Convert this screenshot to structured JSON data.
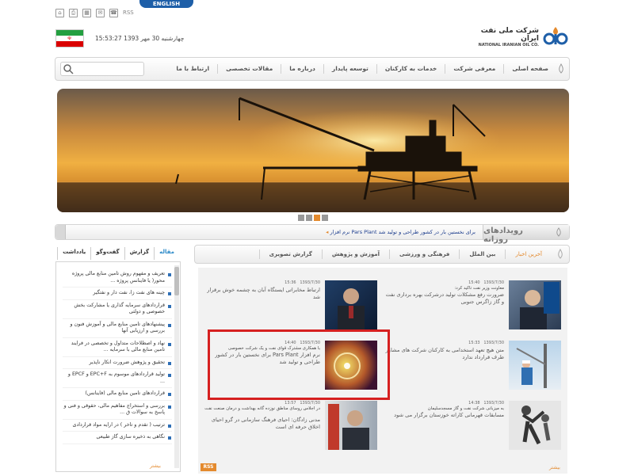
{
  "topbar": {
    "rss_label": "RSS",
    "language_tab": "ENGLISH",
    "icons": [
      "home-icon",
      "print-icon",
      "sitemap-icon",
      "mail-icon",
      "contact-icon"
    ]
  },
  "header": {
    "datetime": "چهارشنبه 30 مهر 1393    15:53:27",
    "logo_fa": "شرکت ملی نفت ایران",
    "logo_en": "NATIONAL IRANIAN OIL CO."
  },
  "nav": {
    "items": [
      "صفحه اصلی",
      "معرفی شرکت",
      "خدمات به کارکنان",
      "توسعه پایدار",
      "درباره ما",
      "مقالات تخصصی",
      "ارتباط با ما"
    ],
    "search_placeholder": ""
  },
  "ticker": {
    "title": "رویدادهای روزانه",
    "text": "نرم افزار Pars Plant برای نخستین بار در کشور طراحی و تولید شد"
  },
  "sidebar": {
    "tabs": [
      "مقاله",
      "گزارش",
      "گفت‌وگو",
      "یادداشت"
    ],
    "items": [
      "تعریف و مفهوم روش تامین منابع مالی پروژه محور( یا فاینانس پروژه ...",
      "چینه های نفت زا، نفت دار و نفتگیر",
      "قراردادهای سرمایه گذاری یا مشارکت بخش خصوصی و دولتی",
      "پیشنهادهای تامین منابع مالی و آموزش فنون و بررسی و ارزیابی آنها",
      "نهاد و اصطلاحات متداول و تخصصی در فرایند تامین منابع مالی با سرمایه ...",
      "تحقیق و پژوهش ضرورت انکار ناپذیر",
      "تولید قراردادهای موسوم به EPC+F و EPCF و ...",
      "قراردادهای تامین منابع مالی (فاینانس)",
      "بررسی و استخراج مفاهیم مالی، حقوقی و فنی و پاسخ به سوالات ق ...",
      "ترتیب ( تقدم و تاخر ) در ارایه مواد قراردادی",
      "نگاهی به ذخیره سازی گاز طبیعی"
    ],
    "more": "بیشتر"
  },
  "news": {
    "tabs": [
      "آخرین اخبار",
      "بین الملل",
      "فرهنگی و ورزشی",
      "آموزش و پژوهش",
      "گزارش تصویری"
    ],
    "items": [
      {
        "date": "1393/7/30",
        "time": "15:40",
        "subtitle": "معاونت وزیر نفت تاکید کرد:",
        "title": "ضرورت رفع مشکلات تولید درشرکت بهره برداری نفت و گاز زاگرس جنوبی"
      },
      {
        "date": "1393/7/30",
        "time": "15:36",
        "subtitle": "",
        "title": "ارتباط مخابراتی ایستگاه آبان به چشمه خوش برقرار شد"
      },
      {
        "date": "1393/7/30",
        "time": "15:33",
        "subtitle": "",
        "title": "متن هیچ تعهد استخدامی به کارکنان شرکت های مشاور طرف قرارداد ندارد"
      },
      {
        "date": "1393/7/30",
        "time": "14:40",
        "subtitle": "با همکاری مشترک قوای نفت و یک شرکت خصوصی",
        "title": "نرم افزار Pars Plant برای نخستین بار در کشور طراحی و تولید شد"
      },
      {
        "date": "1393/7/30",
        "time": "14:38",
        "subtitle": "به میزبانی شرکت نفت و گاز مسجدسلیمان",
        "title": "مسابقات قهرمانی کاراته خوزستان برگزار می شود"
      },
      {
        "date": "1393/7/30",
        "time": "13:57",
        "subtitle": "در اجلاس روسای مناطق نوزده گانه بهداشت و درمان صنعت نفت",
        "title": "مدنی زادگان: احیای فرهنگ سازمانی در گرو احیای اخلاق حرفه ای است"
      }
    ],
    "more": "بیشتر",
    "rss": "RSS"
  }
}
